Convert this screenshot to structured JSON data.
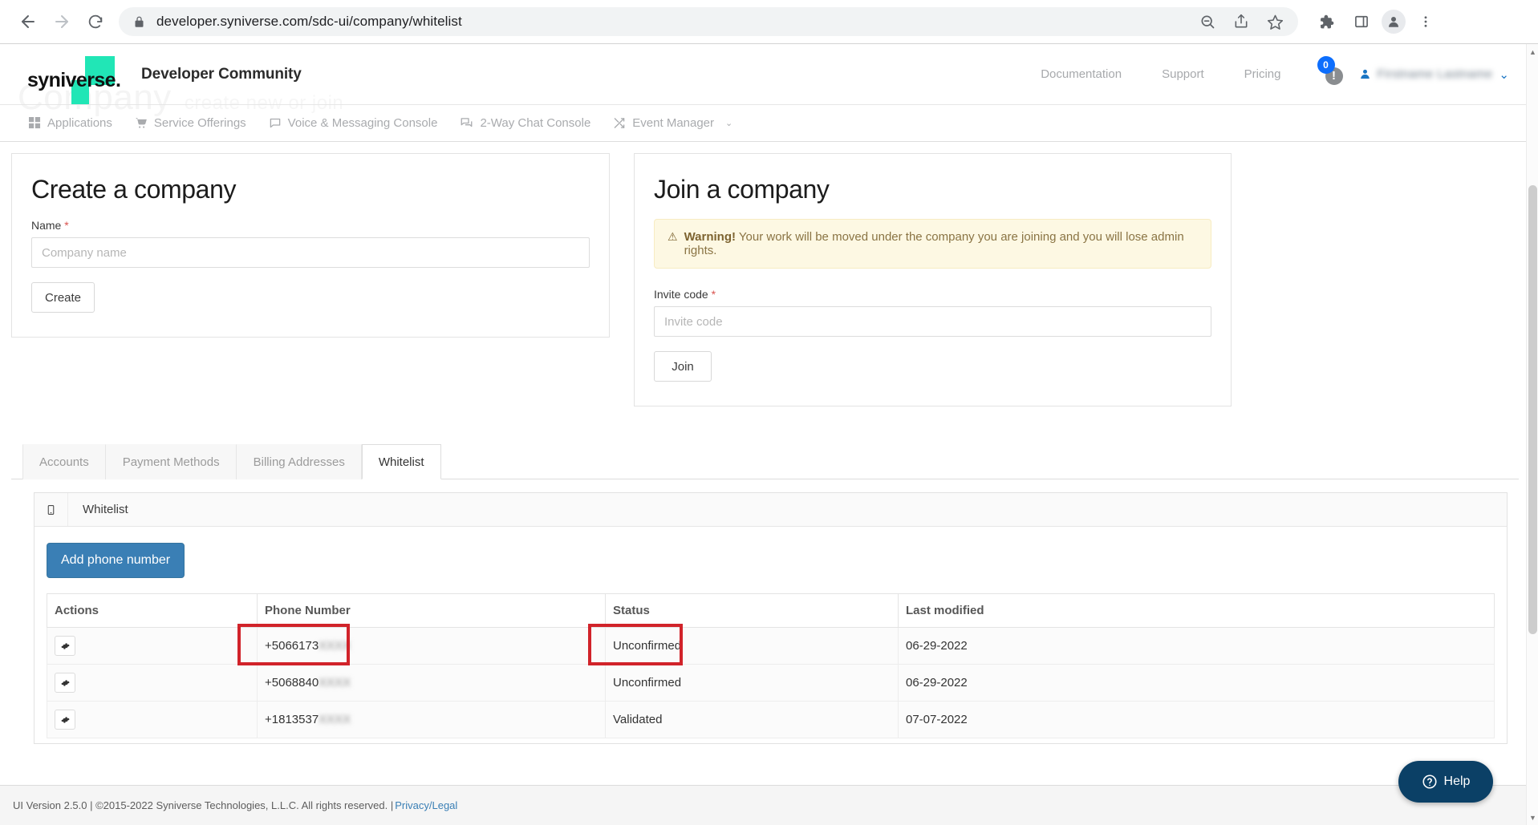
{
  "browser": {
    "url": "developer.syniverse.com/sdc-ui/company/whitelist",
    "back_label": "Back",
    "forward_label": "Forward",
    "reload_label": "Reload",
    "lock_label": "View site information",
    "zoom_out_label": "Zoom out",
    "share_label": "Share this page",
    "bookmark_label": "Bookmark this tab",
    "extensions_label": "Extensions",
    "side_panel_label": "Side panel",
    "profile_label": "Profile",
    "menu_label": "Customize and control Google Chrome"
  },
  "watermark": {
    "title": "Company",
    "subtitle": "create new or join"
  },
  "header": {
    "logo_text": "syniverse",
    "logo_dot": ".",
    "brand_title": "Developer Community",
    "links": [
      {
        "label": "Documentation"
      },
      {
        "label": "Support"
      },
      {
        "label": "Pricing"
      }
    ],
    "notification_count": "0",
    "notification_mark": "!",
    "user_name": "Firstname Lastname",
    "user_caret": "⌄"
  },
  "nav": {
    "items": [
      {
        "label": "Applications",
        "icon": "grid-icon"
      },
      {
        "label": "Service Offerings",
        "icon": "cart-icon"
      },
      {
        "label": "Voice & Messaging Console",
        "icon": "comment-icon"
      },
      {
        "label": "2-Way Chat Console",
        "icon": "comments-icon"
      },
      {
        "label": "Event Manager",
        "icon": "shuffle-icon",
        "caret": "⌄"
      }
    ]
  },
  "create_company": {
    "title": "Create a company",
    "name_label": "Name",
    "required_mark": "*",
    "name_value": "",
    "name_placeholder": "Company name",
    "create_button": "Create"
  },
  "join_company": {
    "title": "Join a company",
    "warning_triangle": "⚠",
    "warning_strong": "Warning!",
    "warning_text": "Your work will be moved under the company you are joining and you will lose admin rights.",
    "invite_label": "Invite code",
    "required_mark": "*",
    "invite_value": "",
    "invite_placeholder": "Invite code",
    "join_button": "Join"
  },
  "tabs": [
    {
      "label": "Accounts",
      "active": false
    },
    {
      "label": "Payment Methods",
      "active": false
    },
    {
      "label": "Billing Addresses",
      "active": false
    },
    {
      "label": "Whitelist",
      "active": true
    }
  ],
  "whitelist_card": {
    "icon": "mobile-phone-icon",
    "title": "Whitelist",
    "add_button": "Add phone number",
    "columns": [
      "Actions",
      "Phone Number",
      "Status",
      "Last modified"
    ],
    "rows": [
      {
        "action_icon": "gear-icon",
        "phone_visible": "+5066173",
        "phone_redacted": "XXXX",
        "status": "Unconfirmed",
        "last_modified": "06-29-2022",
        "highlight_phone": false,
        "highlight_status": false
      },
      {
        "action_icon": "gear-icon",
        "phone_visible": "+5068840",
        "phone_redacted": "XXXX",
        "status": "Unconfirmed",
        "last_modified": "06-29-2022",
        "highlight_phone": false,
        "highlight_status": false
      },
      {
        "action_icon": "gear-icon",
        "phone_visible": "+1813537",
        "phone_redacted": "XXXX",
        "status": "Validated",
        "last_modified": "07-07-2022",
        "highlight_phone": true,
        "highlight_status": true
      }
    ]
  },
  "footer": {
    "text": "UI Version 2.5.0 | ©2015-2022 Syniverse Technologies, L.L.C. All rights reserved. |",
    "link": "Privacy/Legal"
  },
  "help_widget": {
    "label": "Help",
    "icon": "question-circle-icon"
  },
  "colors": {
    "accent_teal": "#21e6b6",
    "primary_blue": "#3a7fb5",
    "badge_blue": "#0d6efd",
    "warning_bg": "#fdf8e3",
    "annotation_red": "#d1232a",
    "help_navy": "#0b4066"
  }
}
